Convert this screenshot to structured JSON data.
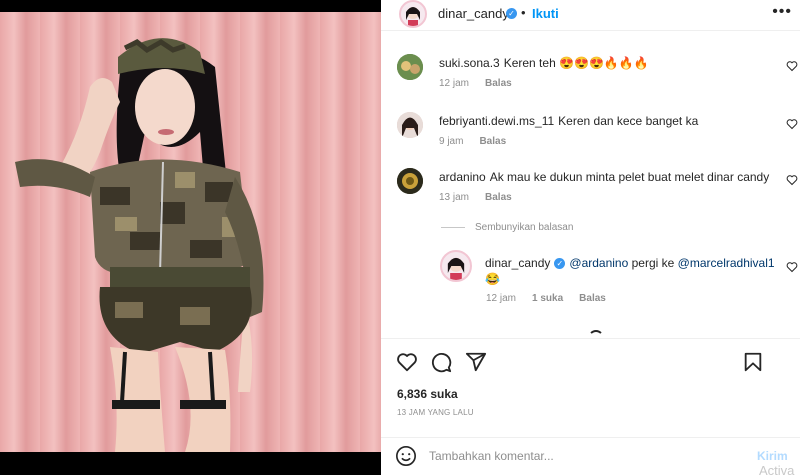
{
  "post": {
    "author": "dinar_candy",
    "follow_label": "Ikuti",
    "separator": "•",
    "more_icon": "more-horizontal-icon"
  },
  "comments": [
    {
      "username": "suki.sona.3",
      "text": "Keren teh 😍😍😍🔥🔥🔥",
      "time": "12 jam",
      "reply_label": "Balas"
    },
    {
      "username": "febriyanti.dewi.ms_11",
      "text": "Keren dan kece banget ka",
      "time": "9 jam",
      "reply_label": "Balas"
    },
    {
      "username": "ardanino",
      "text": "Ak mau ke dukun minta pelet buat melet dinar candy",
      "time": "13 jam",
      "reply_label": "Balas"
    }
  ],
  "hide_replies_label": "Sembunyikan balasan",
  "reply": {
    "username": "dinar_candy",
    "mention1": "@ardanino",
    "middle": "pergi ke",
    "mention2": "@marcelradhival1",
    "emoji": "😂",
    "time": "12 jam",
    "likes": "1 suka",
    "reply_label": "Balas"
  },
  "actions": {
    "like_icon": "heart-icon",
    "comment_icon": "comment-icon",
    "share_icon": "share-icon",
    "save_icon": "bookmark-icon",
    "likes_count": "6,836 suka",
    "time_ago": "13 JAM YANG LALU"
  },
  "composer": {
    "placeholder": "Tambahkan komentar...",
    "post_label": "Kirim",
    "emoji_icon": "smiley-icon"
  },
  "watermark": "Activa",
  "colors": {
    "accent": "#0095f6",
    "verified": "#3897f0",
    "muted": "#8e8e8e",
    "post_disabled": "#b3dbff"
  }
}
